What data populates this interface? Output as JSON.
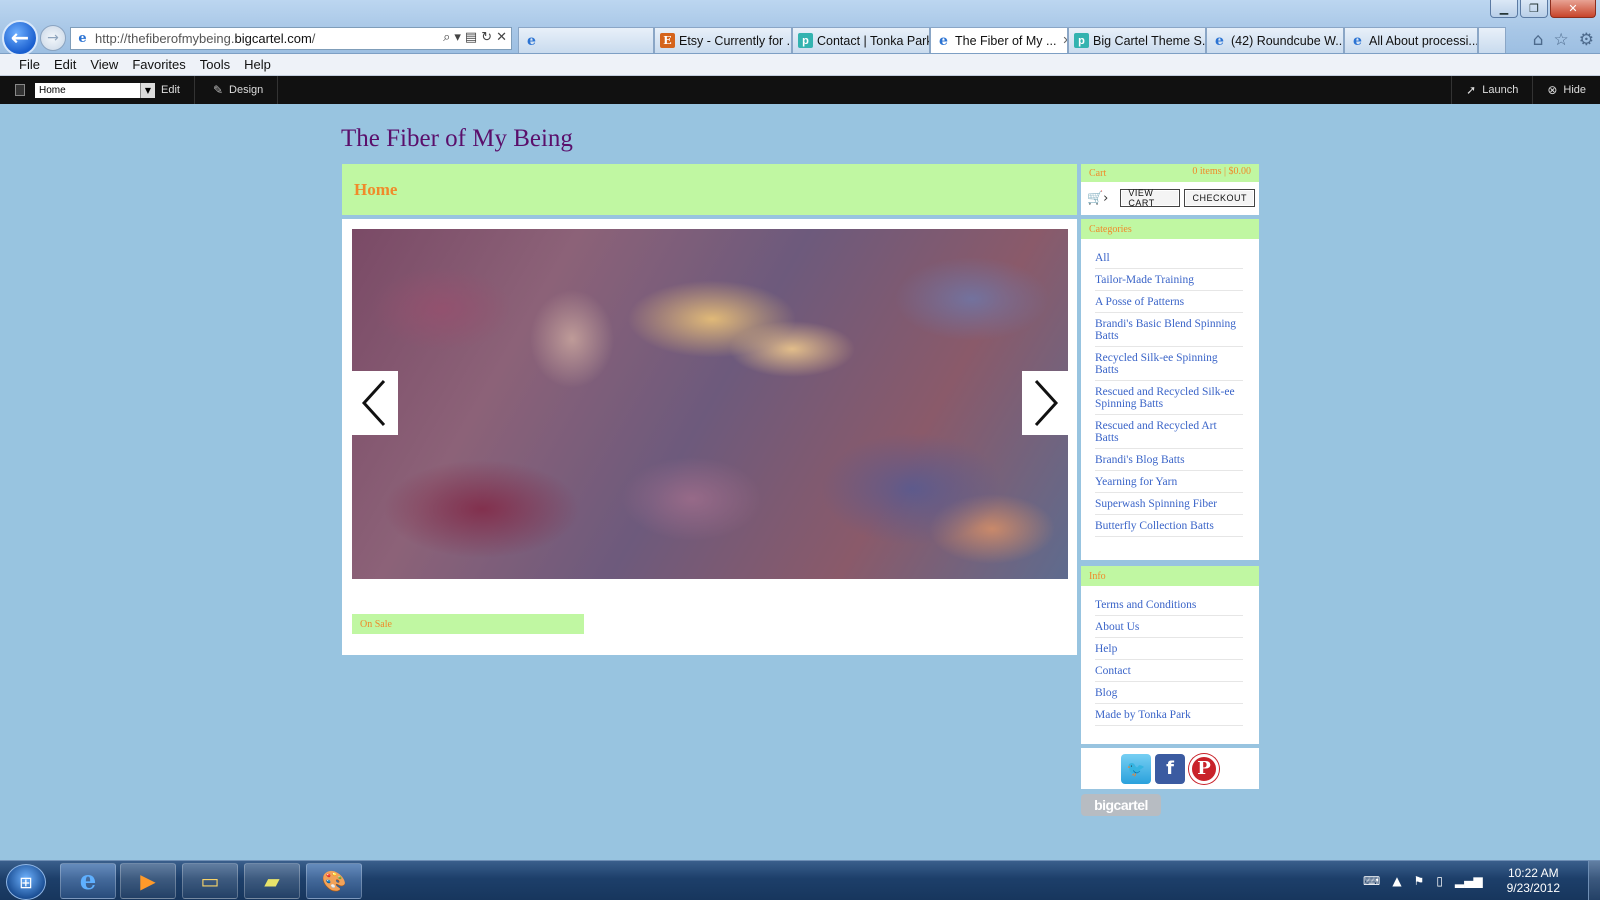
{
  "browser": {
    "url_prefix": "http://thefiberofmybeing.",
    "url_domain": "bigcartel.com",
    "url_suffix": "/",
    "tabs": [
      {
        "label": "",
        "favicon": "ie-icon"
      },
      {
        "label": "Etsy - Currently for ...",
        "favicon": "etsy-icon"
      },
      {
        "label": "Contact | Tonka Park",
        "favicon": "tonkapark-icon"
      },
      {
        "label": "The Fiber of My ...",
        "favicon": "ie-icon",
        "active": true
      },
      {
        "label": "Big Cartel Theme S...",
        "favicon": "tonkapark-icon"
      },
      {
        "label": "(42) Roundcube W...",
        "favicon": "ie-icon"
      },
      {
        "label": "All About processi...",
        "favicon": "ie-icon"
      }
    ],
    "menu": [
      "File",
      "Edit",
      "View",
      "Favorites",
      "Tools",
      "Help"
    ]
  },
  "admin_bar": {
    "page_select": "Home",
    "edit_label": "Edit",
    "design_label": "Design",
    "launch_label": "Launch",
    "hide_label": "Hide"
  },
  "store": {
    "title": "The Fiber of My Being",
    "page_heading": "Home",
    "on_sale_label": "On Sale",
    "cart": {
      "label": "Cart",
      "summary": "0 items | $0.00",
      "view_cart": "VIEW CART",
      "checkout": "CHECKOUT"
    },
    "categories": {
      "heading": "Categories",
      "items": [
        "All",
        "Tailor-Made Training",
        "A Posse of Patterns",
        "Brandi's Basic Blend Spinning Batts",
        "Recycled Silk-ee Spinning Batts",
        "Rescued and Recycled Silk-ee Spinning Batts",
        "Rescued and Recycled Art Batts",
        "Brandi's Blog Batts",
        "Yearning for Yarn",
        "Superwash Spinning Fiber",
        "Butterfly Collection Batts"
      ]
    },
    "info": {
      "heading": "Info",
      "items": [
        "Terms and Conditions",
        "About Us",
        "Help",
        "Contact",
        "Blog",
        "Made by Tonka Park"
      ]
    },
    "badge": "bigcartel",
    "colors": {
      "background": "#98c4e0",
      "accent_green": "#c0f7a2",
      "accent_orange": "#f08a2a",
      "title_purple": "#5a0f6b",
      "link_blue": "#3a64c8"
    }
  },
  "taskbar": {
    "time": "10:22 AM",
    "date": "9/23/2012"
  }
}
